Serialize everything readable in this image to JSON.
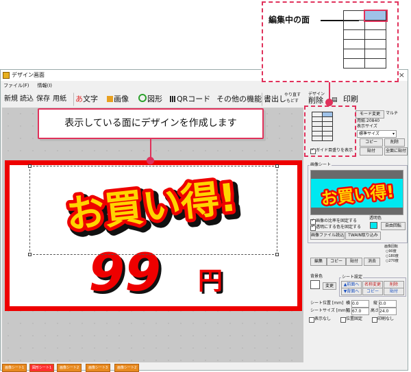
{
  "annotation": {
    "editing_face_label": "編集中の面",
    "callout_text": "表示している面にデザインを作成します"
  },
  "window": {
    "title": "デザイン画面",
    "close_glyph": "×",
    "menu": [
      "ファイル(F)",
      "情報(I)"
    ]
  },
  "toolbar": {
    "new": "新規",
    "open": "読込",
    "save": "保存",
    "paper": "用紙",
    "text_prefix": "あ",
    "text": "文字",
    "image": "画像",
    "shape": "図形",
    "qr": "QRコード",
    "other": "その他の機能",
    "bring_out": "書出し",
    "redo_top": "やり直す",
    "redo_bottom": "もどす",
    "design_top": "デザイン",
    "delete": "削除",
    "print": "印刷"
  },
  "design": {
    "main_text": "お買い得!",
    "price_number": "99",
    "price_unit": "円"
  },
  "right_panel": {
    "mode_change": "モード変更",
    "multi": "マルチ",
    "paper_info": "用紙:20840",
    "display_size_label": "表示サイズ",
    "display_size_value": "標準サイズ",
    "copy": "コピー",
    "delete": "削除",
    "paste": "貼付",
    "paste_all": "全面に貼付",
    "guide_check": "ガイド目盛りを表示",
    "image_sheet_title": "画像シート",
    "preview_text": "お買い得!",
    "keep_ratio": "画像の比率を固定する",
    "transparent": "透明にする色を固定する",
    "transparent_color_label": "透明色",
    "free_rotate": "自由回転",
    "load_image_file": "画像ファイル読込",
    "twain": "TWAIN取り込み",
    "rotate_group_title": "画像回転",
    "rotate_90": "90度",
    "rotate_180": "180度",
    "rotate_270": "270度",
    "edit": "編集",
    "copy2": "コピー",
    "paste2": "貼付",
    "erase": "消去",
    "bg_color_label": "背景色",
    "change": "変更",
    "sheet_settings_title": "シート設定",
    "to_front": "▲前面へ",
    "to_back": "▼背面へ",
    "rename": "名称変更",
    "sheet_copy": "コピー",
    "sheet_delete": "削除",
    "sheet_paste": "貼付",
    "sheet_pos_label": "シート位置 [mm]",
    "x_label": "横",
    "x_value": "0.0",
    "y_label": "縦",
    "y_value": "0.0",
    "sheet_size_label": "シートサイズ [mm]",
    "w_label": "幅",
    "w_value": "67.0",
    "h_label": "高さ",
    "h_value": "24.0",
    "hide": "表示なし",
    "lock_pos": "位置固定",
    "no_print": "印刷なし"
  },
  "sheet_tabs": [
    "画像シート1",
    "図形シート1",
    "画像シート2",
    "画像シート3",
    "画像シート2"
  ],
  "colors": {
    "accent": "#e0305a",
    "card_border": "#ee0000",
    "text_yellow": "#ffd400",
    "text_red": "#ee0000",
    "preview_bg": "#00e8f0",
    "cell_active": "#9fc2e8"
  }
}
